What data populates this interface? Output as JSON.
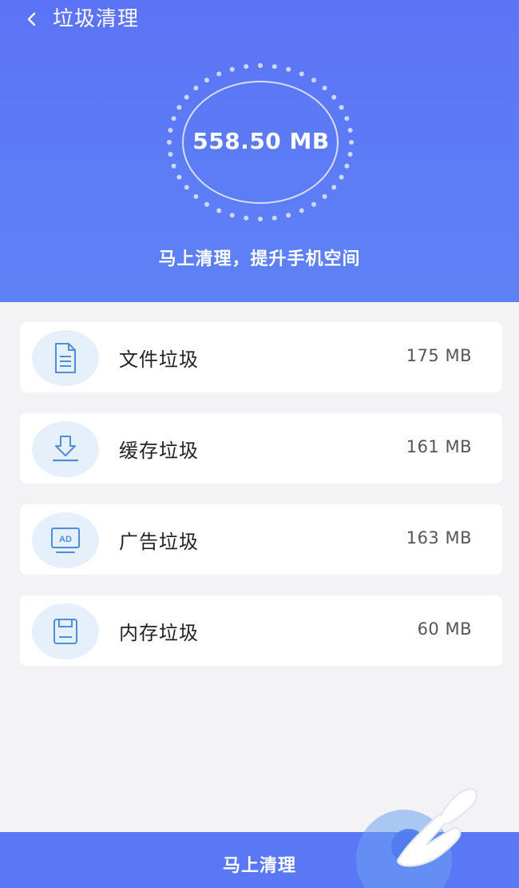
{
  "header": {
    "title": "垃圾清理",
    "total_size": "558.50 MB",
    "tagline": "马上清理，提升手机空间"
  },
  "items": [
    {
      "label": "文件垃圾",
      "size": "175 MB",
      "icon": "document-icon"
    },
    {
      "label": "缓存垃圾",
      "size": "161 MB",
      "icon": "download-icon"
    },
    {
      "label": "广告垃圾",
      "size": "163 MB",
      "icon": "ad-monitor-icon"
    },
    {
      "label": "内存垃圾",
      "size": "60 MB",
      "icon": "floppy-icon"
    }
  ],
  "footer": {
    "button_label": "马上清理"
  },
  "colors": {
    "primary": "#5b74f6",
    "icon_stroke": "#4a8fd8",
    "icon_bg": "#e6f0fb"
  }
}
